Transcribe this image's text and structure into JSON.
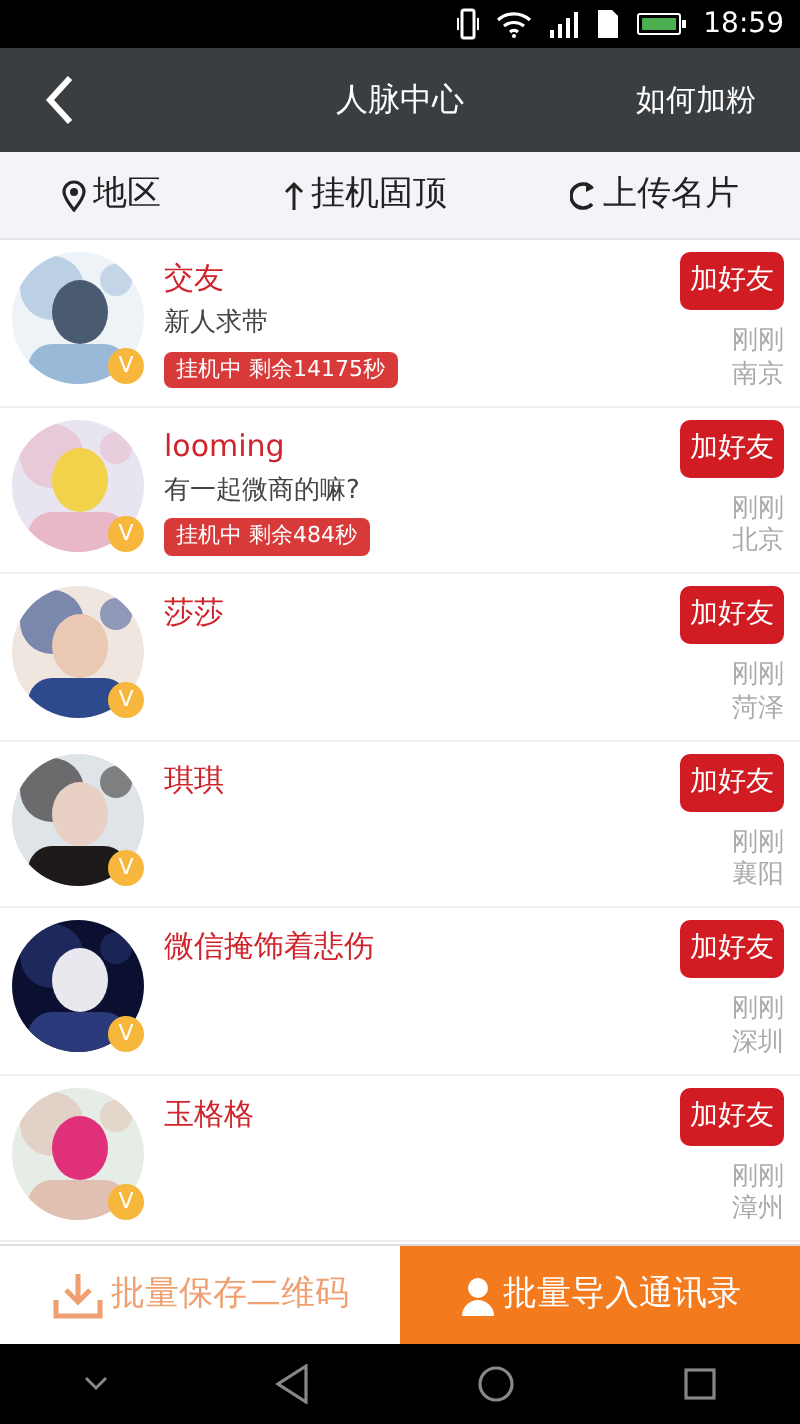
{
  "status_bar": {
    "time": "18:59"
  },
  "header": {
    "title": "人脉中心",
    "action": "如何加粉"
  },
  "filters": [
    {
      "kind": "location",
      "label": "地区"
    },
    {
      "kind": "pin-top",
      "label": "挂机固顶"
    },
    {
      "kind": "upload",
      "label": "上传名片"
    }
  ],
  "contacts": [
    {
      "name": "交友",
      "message": "新人求带",
      "tag": "挂机中 剩余14175秒",
      "badge": "V",
      "button": "加好友",
      "time": "刚刚",
      "city": "南京"
    },
    {
      "name": "looming",
      "message": "有一起微商的嘛?",
      "tag": "挂机中 剩余484秒",
      "badge": "V",
      "button": "加好友",
      "time": "刚刚",
      "city": "北京"
    },
    {
      "name": "莎莎",
      "badge": "V",
      "button": "加好友",
      "time": "刚刚",
      "city": "菏泽"
    },
    {
      "name": "琪琪",
      "badge": "V",
      "button": "加好友",
      "time": "刚刚",
      "city": "襄阳"
    },
    {
      "name": "微信掩饰着悲伤",
      "badge": "V",
      "button": "加好友",
      "time": "刚刚",
      "city": "深圳"
    },
    {
      "name": "玉格格",
      "badge": "V",
      "button": "加好友",
      "time": "刚刚",
      "city": "漳州"
    }
  ],
  "bottom_actions": [
    {
      "kind": "outline",
      "label": "批量保存二维码"
    },
    {
      "kind": "filled",
      "label": "批量导入通讯录"
    }
  ]
}
